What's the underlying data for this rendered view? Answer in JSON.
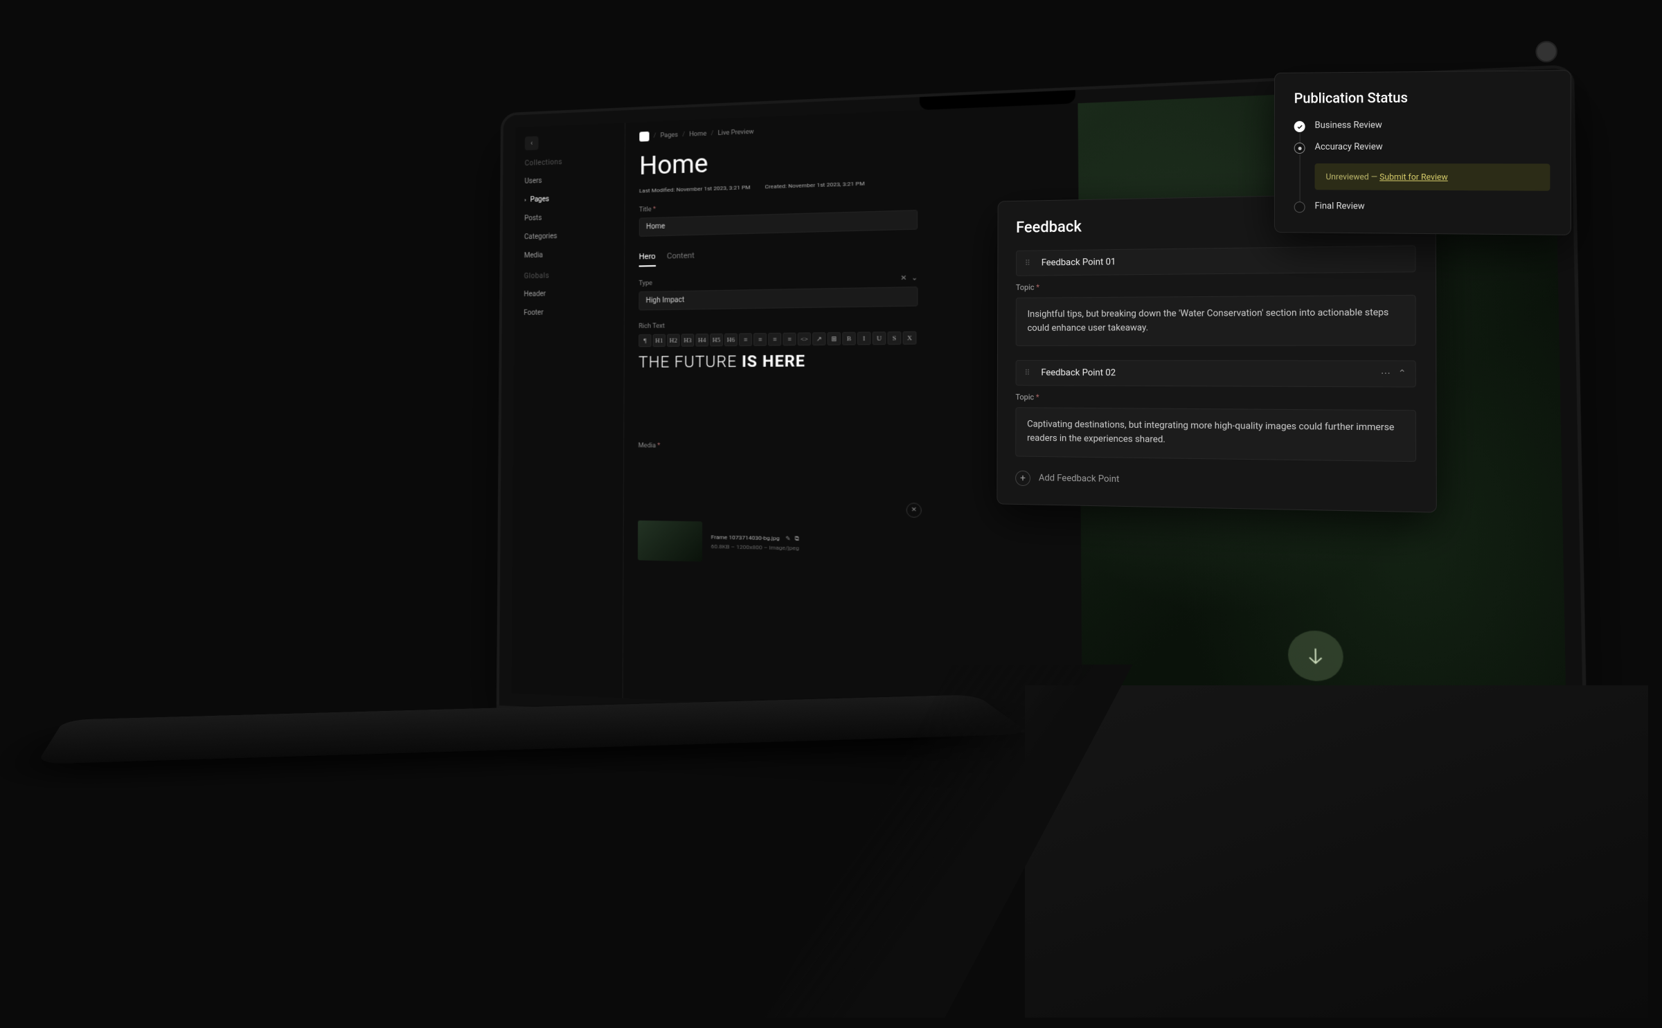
{
  "breadcrumb": {
    "items": [
      "Pages",
      "Home",
      "Live Preview"
    ]
  },
  "sidebar": {
    "collapse_glyph": "‹",
    "sections": [
      {
        "label": "Collections",
        "items": [
          {
            "label": "Users"
          },
          {
            "label": "Pages",
            "active": true,
            "chev": "›"
          },
          {
            "label": "Posts"
          },
          {
            "label": "Categories"
          },
          {
            "label": "Media"
          }
        ]
      },
      {
        "label": "Globals",
        "items": [
          {
            "label": "Header"
          },
          {
            "label": "Footer"
          }
        ]
      }
    ]
  },
  "page": {
    "title": "Home",
    "last_modified_label": "Last Modified:",
    "last_modified": "November 1st 2023, 3:21 PM",
    "created_label": "Created:",
    "created": "November 1st 2023, 3:21 PM",
    "title_field_label": "Title",
    "title_value": "Home",
    "tabs": [
      {
        "label": "Hero",
        "active": true
      },
      {
        "label": "Content"
      }
    ],
    "type_label": "Type",
    "type_value": "High Impact",
    "pill_x": "✕",
    "pill_caret": "⌄",
    "richtext_label": "Rich Text",
    "richtext_line1": "THE FUTURE ",
    "richtext_line2": "IS HERE",
    "toolbar": [
      "¶",
      "H1",
      "H2",
      "H3",
      "H4",
      "H5",
      "H6",
      "≡",
      "≡",
      "≡",
      "≡",
      "<>",
      "↗",
      "⊞",
      "B",
      "I",
      "U",
      "S",
      "X"
    ],
    "media_label": "Media",
    "media_filename": "Frame 1073714030-bg.jpg",
    "media_meta": "60.8KB – 1200x800 – image/jpeg",
    "media_icon_edit": "✎",
    "media_icon_copy": "⧉",
    "clear_glyph": "✕"
  },
  "feedback": {
    "title": "Feedback",
    "points": [
      {
        "heading": "Feedback Point 01",
        "topic_label": "Topic",
        "required": "*",
        "text": "Insightful tips, but breaking down the 'Water Conservation' section into actionable steps could enhance user takeaway."
      },
      {
        "heading": "Feedback Point 02",
        "topic_label": "Topic",
        "required": "*",
        "text": "Captivating destinations, but integrating more high-quality images could further immerse readers in the experiences shared.",
        "more": "⋯",
        "caret": "⌃"
      }
    ],
    "add_label": "Add Feedback Point",
    "plus": "+",
    "grip": "⠿"
  },
  "pub": {
    "title": "Publication Status",
    "steps": [
      {
        "label": "Business Review",
        "state": "done"
      },
      {
        "label": "Accuracy Review",
        "state": "active"
      },
      {
        "label": "Final Review",
        "state": "pending"
      }
    ],
    "callout_prefix": "Unreviewed — ",
    "callout_link": "Submit for Review"
  }
}
